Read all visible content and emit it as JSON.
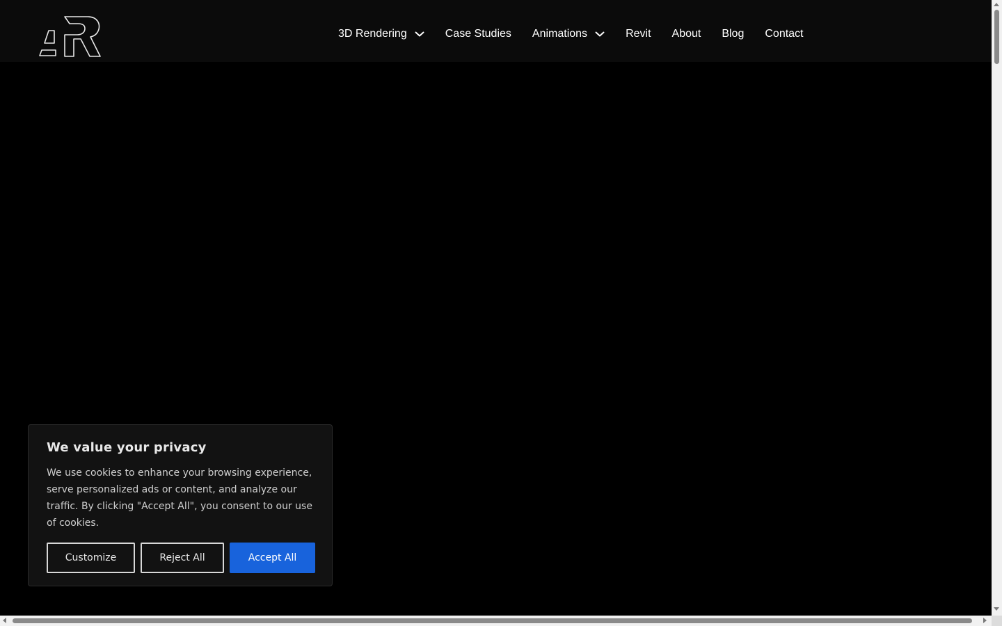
{
  "header": {
    "logo_icon": "ar-logo-icon",
    "nav": [
      {
        "label": "3D Rendering",
        "has_dropdown": true
      },
      {
        "label": "Case Studies",
        "has_dropdown": false
      },
      {
        "label": "Animations",
        "has_dropdown": true
      },
      {
        "label": "Revit",
        "has_dropdown": false
      },
      {
        "label": "About",
        "has_dropdown": false
      },
      {
        "label": "Blog",
        "has_dropdown": false
      },
      {
        "label": "Contact",
        "has_dropdown": false
      }
    ]
  },
  "cookie_banner": {
    "title": "We value your privacy",
    "text": "We use cookies to enhance your browsing experience, serve personalized ads or content, and analyze our traffic. By clicking \"Accept All\", you consent to our use of cookies.",
    "customize_label": "Customize",
    "reject_label": "Reject All",
    "accept_label": "Accept All",
    "accept_color": "#1863dc"
  },
  "colors": {
    "background": "#000000",
    "header_background": "#0b0b0b",
    "banner_background": "#121212"
  }
}
